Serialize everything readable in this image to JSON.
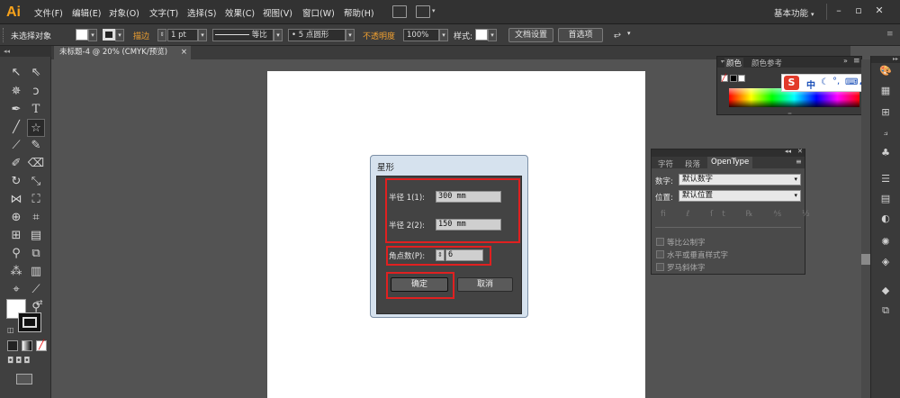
{
  "app": {
    "logo": "Ai"
  },
  "menu": [
    "文件(F)",
    "编辑(E)",
    "对象(O)",
    "文字(T)",
    "选择(S)",
    "效果(C)",
    "视图(V)",
    "窗口(W)",
    "帮助(H)"
  ],
  "workspace": "基本功能",
  "controlbar": {
    "selection": "未选择对象",
    "stroke_label": "描边",
    "stroke_weight": "1 pt",
    "profile": "等比",
    "brush": "5 点圆形",
    "opacity_label": "不透明度",
    "opacity": "100%",
    "style_label": "样式:",
    "doc_setup": "文档设置",
    "preferences": "首选项"
  },
  "document_tab": {
    "title": "未标题-4 @ 20% (CMYK/预览)",
    "close": "×"
  },
  "dialog": {
    "title": "星形",
    "radius1_label": "半径 1(1):",
    "radius1_value": "300 mm",
    "radius2_label": "半径 2(2):",
    "radius2_value": "150 mm",
    "points_label": "角点数(P):",
    "points_value": "6",
    "ok": "确定",
    "cancel": "取消"
  },
  "color_panel": {
    "tab_color": "颜色",
    "tab_guide": "颜色参考"
  },
  "ime": {
    "text": "中"
  },
  "opentype_panel": {
    "tabs": [
      "字符",
      "段落",
      "OpenType"
    ],
    "figure_label": "数字:",
    "figure_value": "默认数字",
    "position_label": "位置:",
    "position_value": "默认位置",
    "options": [
      "等比公制字",
      "水平或垂直样式字",
      "罗马斜体字"
    ]
  },
  "colors": {
    "accent": "#f0a030",
    "highlight": "#e02020",
    "dialog_frame": "#d6e2ee"
  }
}
